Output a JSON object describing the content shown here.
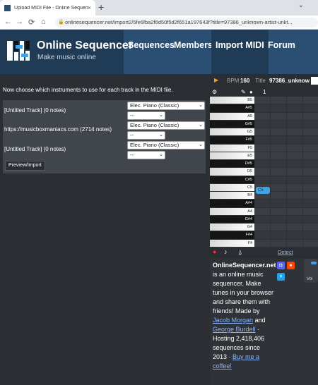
{
  "browser": {
    "tab_title": "Upload MIDI File - Online Sequen...",
    "tab_close": "×",
    "new_tab": "+",
    "tab_menu": "⌄",
    "back": "←",
    "forward": "→",
    "reload": "⟳",
    "home": "⌂",
    "url": "onlinesequencer.net/import2/5fe6fba2f6d50f5d2f651a197643f?title=97386_unknown-artist-unkt..."
  },
  "site": {
    "brand": "Online Sequencer",
    "tagline": "Make music online",
    "nav": [
      "Sequences",
      "Members",
      "Import MIDI",
      "Forum"
    ]
  },
  "import": {
    "prompt": "Now choose which instruments to use for each track in the MIDI file.",
    "tracks": [
      {
        "name": "[Untitled Track] (0 notes)",
        "instrument": "Elec. Piano (Classic)",
        "option": "--"
      },
      {
        "name": "https://musicboxmaniacs.com (2714 notes)",
        "instrument": "Elec. Piano (Classic)",
        "option": "--"
      },
      {
        "name": "[Untitled Track] (0 notes)",
        "instrument": "Elec. Piano (Classic)",
        "option": "--"
      }
    ],
    "button": "Preview/Import"
  },
  "editor": {
    "bpm_label": "BPM",
    "bpm_value": "160",
    "title_label": "Title",
    "title_value": "97386_unknow",
    "measure": "1",
    "keys": [
      "B5",
      "A#5",
      "A5",
      "G#5",
      "G5",
      "F#5",
      "F5",
      "E5",
      "D#5",
      "D5",
      "C#5",
      "C5",
      "B4",
      "A#4",
      "A4",
      "G#4",
      "G4",
      "F#4",
      "F4"
    ],
    "note_label": "C5",
    "detect": "Detect",
    "volume_label": "Vol"
  },
  "about": {
    "brand": "OnlineSequencer.net",
    "desc": "is an online music sequencer. Make tunes in your browser and share them with friends! Made by",
    "author1": "Jacob Morgan",
    "and": "and",
    "author2": "George Burdell",
    "stats": "· Hosting 2,418,406 sequences since 2013 ·",
    "coffee": "Buy me a coffee!"
  }
}
